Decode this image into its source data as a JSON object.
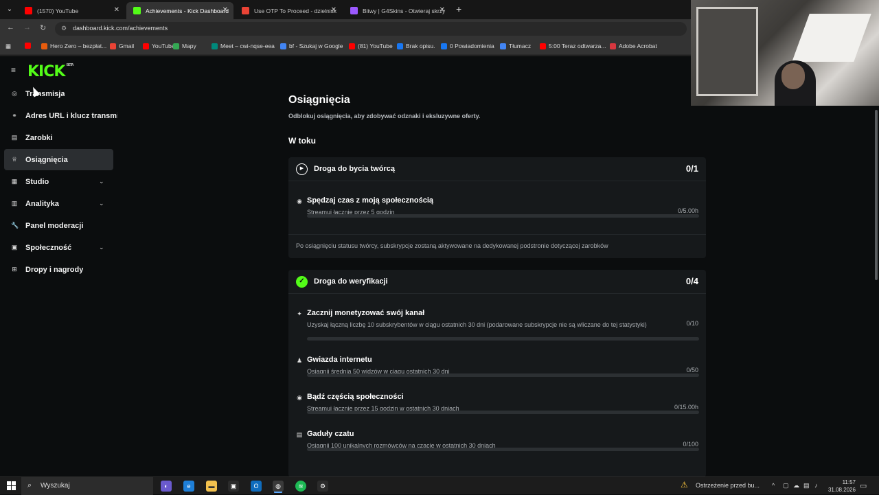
{
  "browser": {
    "tabs": [
      {
        "title": "(1570) YouTube",
        "color": "#ff0000",
        "active": false
      },
      {
        "title": "Achievements - Kick Dashboard",
        "color": "#53fc18",
        "active": true
      },
      {
        "title": "Use OTP To Proceed - dzielnisk",
        "color": "#ea4335",
        "active": false
      },
      {
        "title": "Bitwy | G4Skins - Otwieraj skrzy",
        "color": "#9b59ff",
        "active": false
      }
    ],
    "url": "dashboard.kick.com/achievements",
    "bookmarks": [
      {
        "label": "",
        "color": "#ff0000"
      },
      {
        "label": "Hero Zero – bezpłat...",
        "color": "#e85c0d"
      },
      {
        "label": "Gmail",
        "color": "#ea4335"
      },
      {
        "label": "YouTube",
        "color": "#ff0000"
      },
      {
        "label": "Mapy",
        "color": "#34a853"
      },
      {
        "label": "Meet – cwi-nqse-eea",
        "color": "#00897b"
      },
      {
        "label": "bf - Szukaj w Google",
        "color": "#4285f4"
      },
      {
        "label": "(81) YouTube",
        "color": "#ff0000"
      },
      {
        "label": "Brak opisu.",
        "color": "#1877f2"
      },
      {
        "label": "0 Powiadomienia",
        "color": "#1877f2"
      },
      {
        "label": "Tłumacz",
        "color": "#4285f4"
      },
      {
        "label": "5:00 Teraz odtwarza...",
        "color": "#ff0000"
      },
      {
        "label": "Adobe Acrobat",
        "color": "#d7373f"
      }
    ]
  },
  "sidebar": {
    "logo": "KICK",
    "logo_badge": "BETA",
    "items": [
      {
        "label": "Transmisja",
        "icon": "broadcast-icon",
        "glyph": "◎",
        "chevron": false
      },
      {
        "label": "Adres URL i klucz transmisji",
        "icon": "link-icon",
        "glyph": "⚭",
        "chevron": false
      },
      {
        "label": "Zarobki",
        "icon": "earnings-icon",
        "glyph": "▤",
        "chevron": false
      },
      {
        "label": "Osiągnięcia",
        "icon": "trophy-icon",
        "glyph": "♕",
        "chevron": false
      },
      {
        "label": "Studio",
        "icon": "studio-icon",
        "glyph": "▦",
        "chevron": true
      },
      {
        "label": "Analityka",
        "icon": "analytics-icon",
        "glyph": "▥",
        "chevron": true
      },
      {
        "label": "Panel moderacji",
        "icon": "wrench-icon",
        "glyph": "🔧",
        "chevron": false
      },
      {
        "label": "Społeczność",
        "icon": "community-icon",
        "glyph": "▣",
        "chevron": true
      },
      {
        "label": "Dropy i nagrody",
        "icon": "gift-icon",
        "glyph": "⊞",
        "chevron": false
      }
    ]
  },
  "main": {
    "title": "Osiągnięcia",
    "subtitle": "Odblokuj osiągnięcia, aby zdobywać odznaki i eksluzywne oferty.",
    "section_title": "W toku",
    "cards": [
      {
        "title": "Droga do bycia twórcą",
        "progress": "0/1",
        "icon": "play-icon",
        "tasks": [
          {
            "title": "Spędzaj czas z moją społecznością",
            "desc": "Streamuj łącznie przez 5 godzin",
            "value": "0/5.00h",
            "fraction": 0,
            "icon": "play-icon",
            "glyph": "◉"
          }
        ],
        "note": "Po osiągnięciu statusu twórcy, subskrypcje zostaną aktywowane na dedykowanej podstronie dotyczącej zarobków"
      },
      {
        "title": "Droga do weryfikacji",
        "progress": "0/4",
        "icon": "verified-icon",
        "tasks": [
          {
            "title": "Zacznij monetyzować swój kanał",
            "desc": "Uzyskaj łączną liczbę 10 subskrybentów w ciągu ostatnich 30 dni (podarowane subskrypcje nie są wliczane do tej statystyki)",
            "value": "0/10",
            "fraction": 0,
            "icon": "star-icon",
            "glyph": "✦"
          },
          {
            "title": "Gwiazda internetu",
            "desc": "Osiągnij średnią 50 widzów w ciągu ostatnich 30 dni",
            "value": "0/50",
            "fraction": 0,
            "icon": "people-icon",
            "glyph": "♟"
          },
          {
            "title": "Bądź częścią społeczności",
            "desc": "Streamuj łącznie przez 15 godzin w ostatnich 30 dniach",
            "value": "0/15.00h",
            "fraction": 0,
            "icon": "play-icon",
            "glyph": "◉"
          },
          {
            "title": "Gaduły czatu",
            "desc": "Osiągnij 100 unikalnych rozmówców na czacie w ostatnich 30 dniach",
            "value": "0/100",
            "fraction": 0,
            "icon": "chat-icon",
            "glyph": "▤"
          }
        ]
      }
    ]
  },
  "taskbar": {
    "search_label": "Wyszukaj",
    "warning": "Ostrzeżenie przed bu...",
    "time": "11:57",
    "date": "31.08.2026"
  }
}
